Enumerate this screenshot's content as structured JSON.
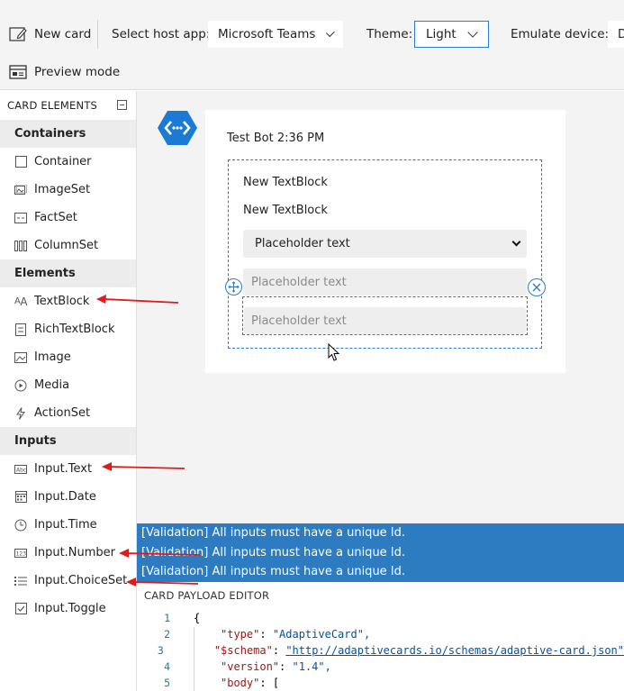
{
  "toolbar": {
    "new_card_label": "New card",
    "host_app_label": "Select host app:",
    "host_app_value": "Microsoft Teams",
    "theme_label": "Theme:",
    "theme_value": "Light",
    "emulate_label": "Emulate device:",
    "emulate_value": "D",
    "preview_mode_label": "Preview mode"
  },
  "sidebar": {
    "header": "CARD ELEMENTS",
    "categories": [
      {
        "label": "Containers",
        "items": [
          {
            "label": "Container",
            "icon": "container-icon"
          },
          {
            "label": "ImageSet",
            "icon": "imageset-icon"
          },
          {
            "label": "FactSet",
            "icon": "factset-icon"
          },
          {
            "label": "ColumnSet",
            "icon": "columnset-icon"
          }
        ]
      },
      {
        "label": "Elements",
        "items": [
          {
            "label": "TextBlock",
            "icon": "textblock-icon"
          },
          {
            "label": "RichTextBlock",
            "icon": "richtextblock-icon"
          },
          {
            "label": "Image",
            "icon": "image-icon"
          },
          {
            "label": "Media",
            "icon": "media-icon"
          },
          {
            "label": "ActionSet",
            "icon": "actionset-icon"
          }
        ]
      },
      {
        "label": "Inputs",
        "items": [
          {
            "label": "Input.Text",
            "icon": "input-text-icon"
          },
          {
            "label": "Input.Date",
            "icon": "input-date-icon"
          },
          {
            "label": "Input.Time",
            "icon": "input-time-icon"
          },
          {
            "label": "Input.Number",
            "icon": "input-number-icon"
          },
          {
            "label": "Input.ChoiceSet",
            "icon": "input-choiceset-icon"
          },
          {
            "label": "Input.Toggle",
            "icon": "input-toggle-icon"
          }
        ]
      }
    ]
  },
  "card": {
    "header": "Test Bot 2:36 PM",
    "textblock1": "New TextBlock",
    "textblock2": "New TextBlock",
    "choiceset_value": "Placeholder text",
    "input_text_placeholder": "Placeholder text",
    "input_number_placeholder": "Placeholder text"
  },
  "validation": {
    "messages": [
      "[Validation] All inputs must have a unique Id.",
      "[Validation] All inputs must have a unique Id.",
      "[Validation] All inputs must have a unique Id."
    ]
  },
  "editor": {
    "header": "CARD PAYLOAD EDITOR",
    "lines": [
      {
        "n": "1",
        "key": "",
        "value": "{"
      },
      {
        "n": "2",
        "key": "\"type\"",
        "value": "\"AdaptiveCard\","
      },
      {
        "n": "3",
        "key": "\"$schema\"",
        "value": "\"http://adaptivecards.io/schemas/adaptive-card.json\""
      },
      {
        "n": "4",
        "key": "\"version\"",
        "value": "\"1.4\","
      },
      {
        "n": "5",
        "key": "\"body\"",
        "value": "["
      }
    ]
  },
  "colors": {
    "accent": "#2a7bd3",
    "validation_bg": "#2d7cc1",
    "annotation_arrow": "#e01b1b",
    "bot_avatar": "#1a7ad4"
  }
}
